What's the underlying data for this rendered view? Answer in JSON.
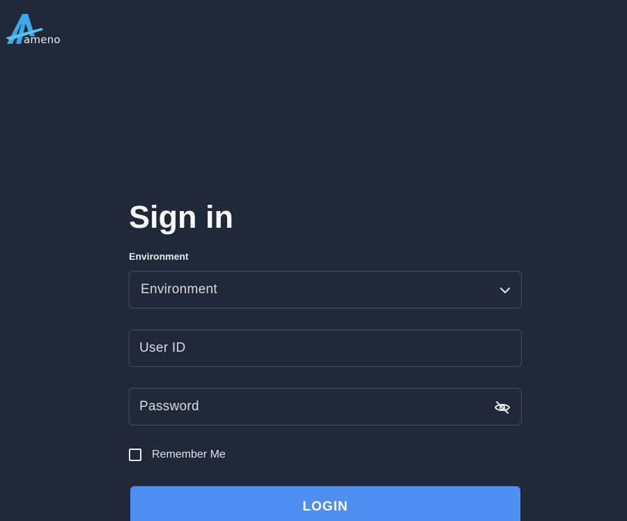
{
  "brand": {
    "name": "ameno",
    "logo_icon": "ameno-logo-icon",
    "accent_color": "#3fa9e8"
  },
  "signin": {
    "title": "Sign in",
    "environment_label": "Environment",
    "environment_select": {
      "value": "Environment",
      "icon": "chevron-down-icon"
    },
    "user_id": {
      "placeholder": "User ID"
    },
    "password": {
      "placeholder": "Password",
      "icon": "eye-off-icon"
    },
    "remember_me": {
      "label": "Remember Me",
      "checked": false
    },
    "login_button": {
      "label": "LOGIN",
      "color": "#4d8ef0"
    }
  },
  "colors": {
    "background": "#212938",
    "field_border": "#434c5c"
  }
}
